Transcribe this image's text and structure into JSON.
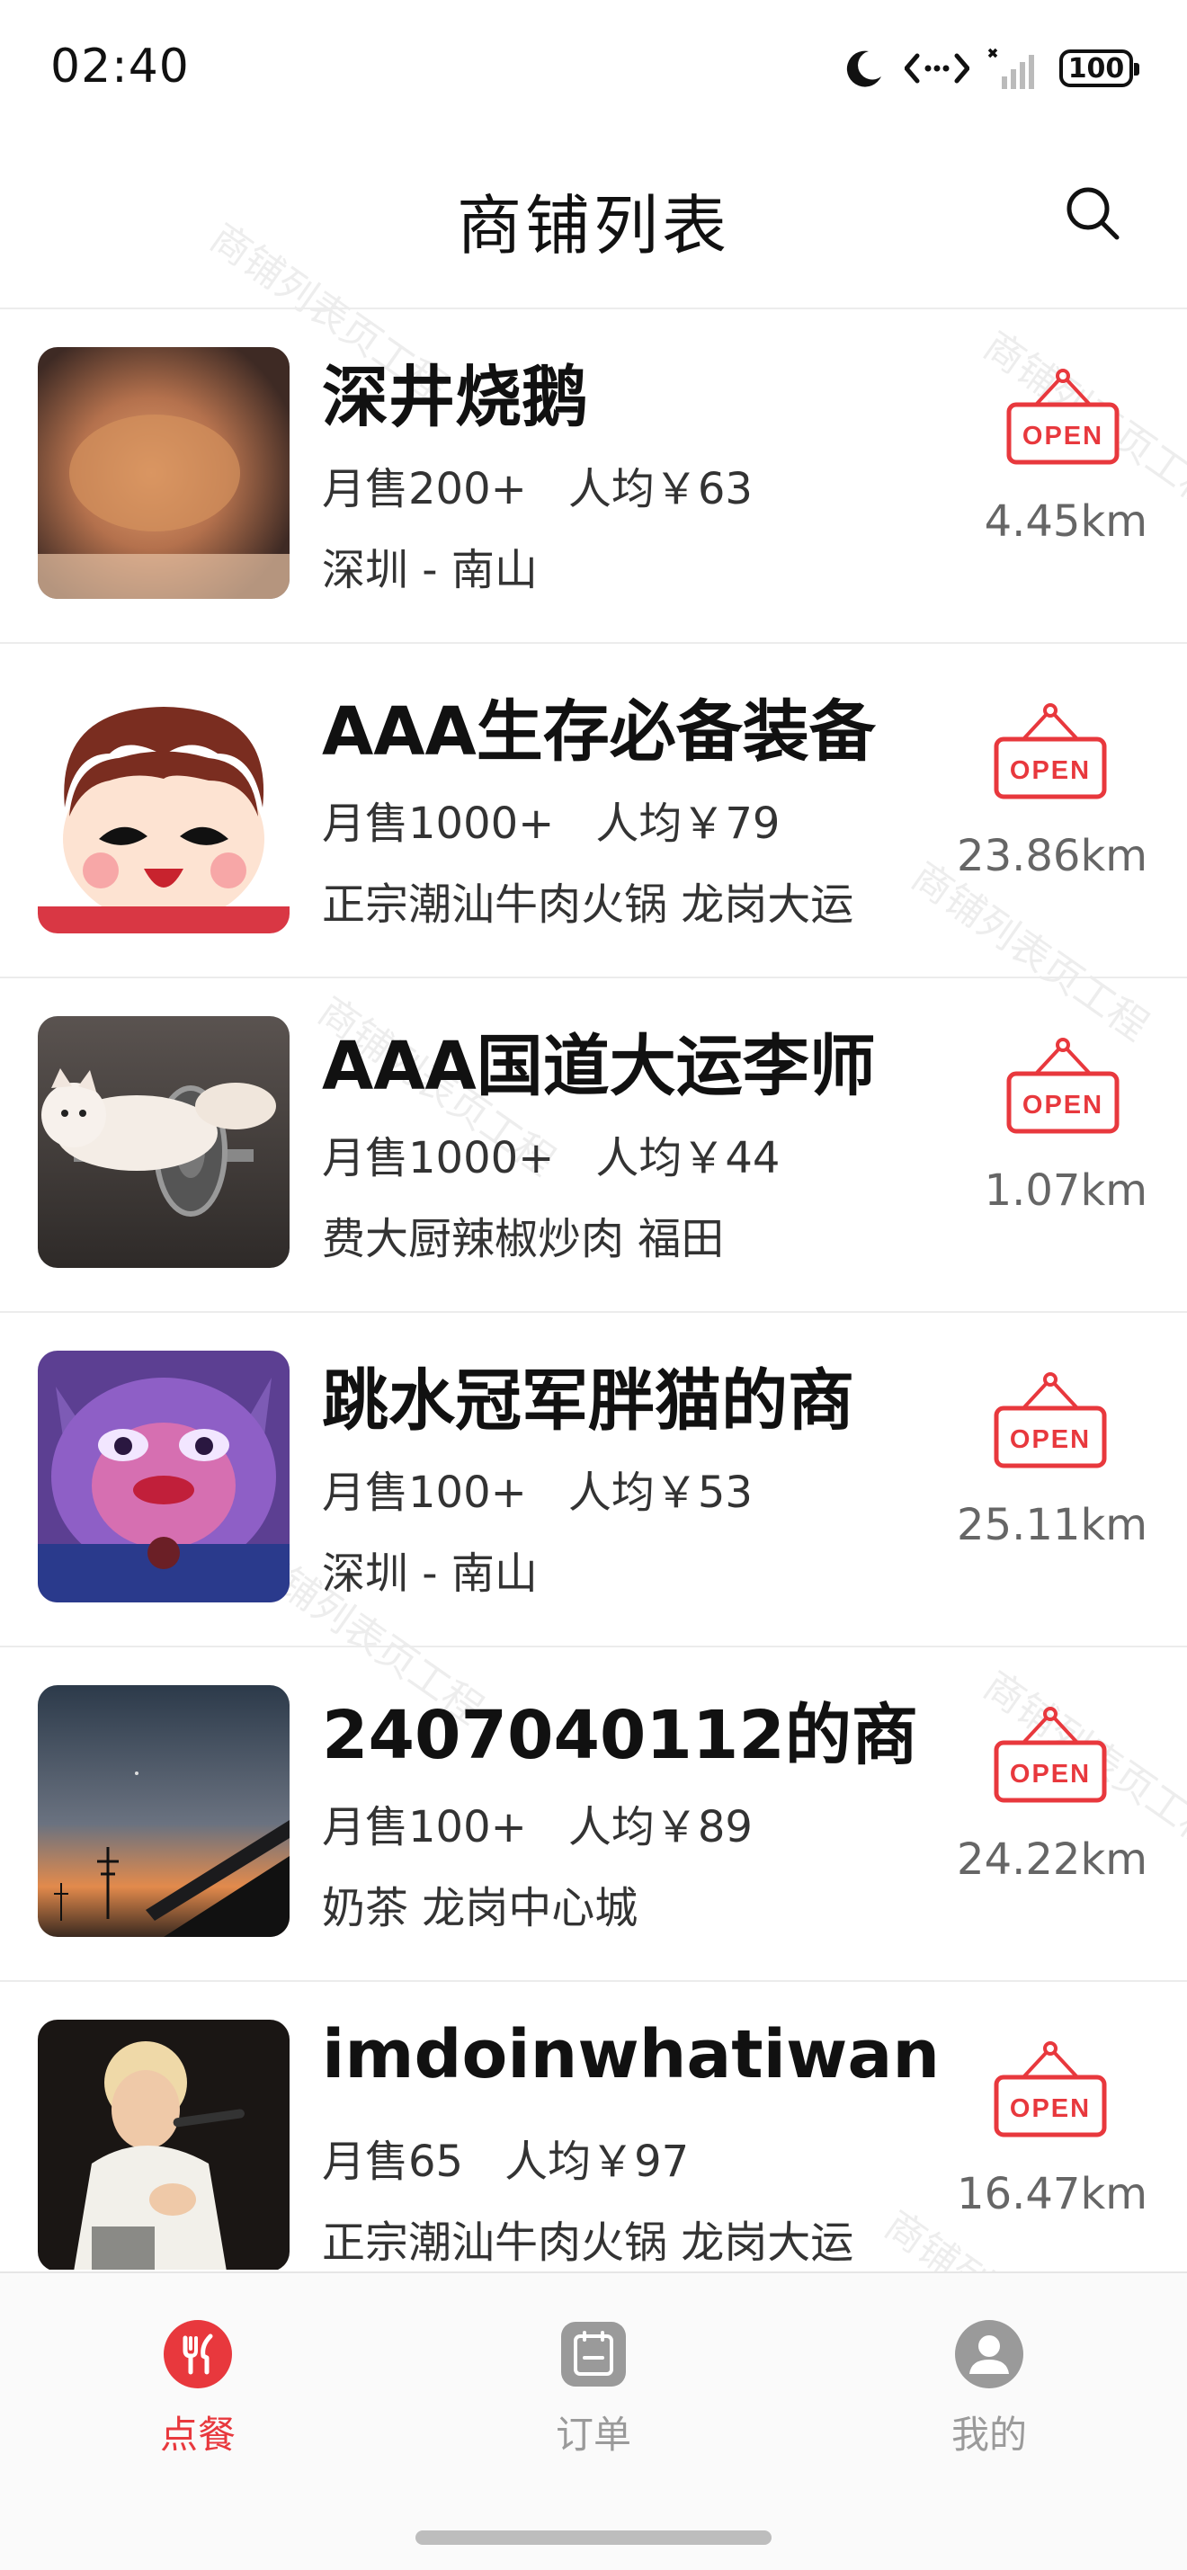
{
  "status_bar": {
    "time": "02:40",
    "battery": "100"
  },
  "header": {
    "title": "商铺列表"
  },
  "shops": [
    {
      "name": "深井烧鹅",
      "sales": "月售200+",
      "avg_price": "人均￥63",
      "address": "深圳 - 南山",
      "distance": "4.45km",
      "status": "OPEN"
    },
    {
      "name": "AAA生存必备装备",
      "sales": "月售1000+",
      "avg_price": "人均￥79",
      "address": "正宗潮汕牛肉火锅   龙岗大运",
      "distance": "23.86km",
      "status": "OPEN"
    },
    {
      "name": "AAA国道大运李师",
      "sales": "月售1000+",
      "avg_price": "人均￥44",
      "address": "费大厨辣椒炒肉  福田",
      "distance": "1.07km",
      "status": "OPEN"
    },
    {
      "name": "跳水冠军胖猫的商",
      "sales": "月售100+",
      "avg_price": "人均￥53",
      "address": "深圳 - 南山",
      "distance": "25.11km",
      "status": "OPEN"
    },
    {
      "name": "2407040112的商",
      "sales": "月售100+",
      "avg_price": "人均￥89",
      "address": "奶茶  龙岗中心城",
      "distance": "24.22km",
      "status": "OPEN"
    },
    {
      "name": "imdoinwhatiwan",
      "sales": "月售65",
      "avg_price": "人均￥97",
      "address": "正宗潮汕牛肉火锅   龙岗大运",
      "distance": "16.47km",
      "status": "OPEN"
    }
  ],
  "tabs": [
    {
      "label": "点餐",
      "icon": "fork-knife-icon",
      "active": true
    },
    {
      "label": "订单",
      "icon": "clipboard-icon",
      "active": false
    },
    {
      "label": "我的",
      "icon": "person-icon",
      "active": false
    }
  ],
  "watermark": "商铺列表页工程",
  "colors": {
    "accent": "#e8383d",
    "inactive": "#9a9a9a",
    "text": "#111111"
  }
}
